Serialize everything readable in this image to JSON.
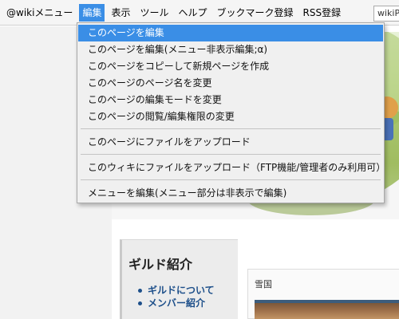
{
  "menubar": {
    "items": [
      {
        "label": "@wikiメニュー"
      },
      {
        "label": "編集"
      },
      {
        "label": "表示"
      },
      {
        "label": "ツール"
      },
      {
        "label": "ヘルプ"
      },
      {
        "label": "ブックマーク登録"
      },
      {
        "label": "RSS登録"
      }
    ],
    "search_value": "wikiP"
  },
  "edit_menu": {
    "items": [
      {
        "label": "このページを編集"
      },
      {
        "label": "このページを編集(メニュー非表示編集;α)"
      },
      {
        "label": "このページをコピーして新規ページを作成"
      },
      {
        "label": "このページのページ名を変更"
      },
      {
        "label": "このページの編集モードを変更"
      },
      {
        "label": "このページの閲覧/編集権限の変更"
      },
      {
        "label": "このページにファイルをアップロード"
      },
      {
        "label": "このウィキにファイルをアップロード（FTP機能/管理者のみ利用可）"
      },
      {
        "label": "メニューを編集(メニュー部分は非表示で編集)"
      }
    ]
  },
  "sidebar": {
    "title": "ギルド紹介",
    "links": [
      {
        "label": "ギルドについて"
      },
      {
        "label": "メンバー紹介"
      }
    ]
  },
  "content": {
    "panel_title": "雪国"
  },
  "colors": {
    "highlight": "#3a8ee6",
    "link": "#1d4f8a"
  }
}
